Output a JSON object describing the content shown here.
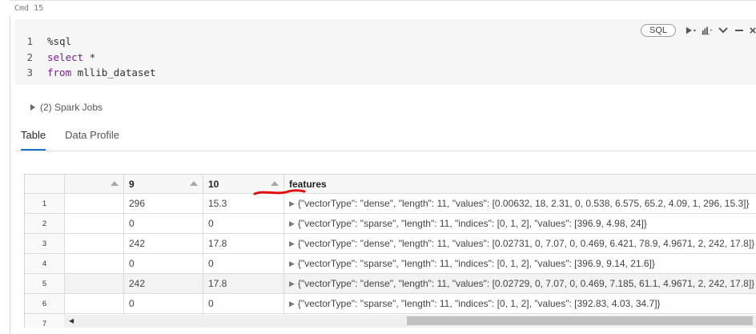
{
  "cell": {
    "label": "Cmd 15",
    "code_lines": [
      {
        "number": "1",
        "keyword": "",
        "rest": "%sql"
      },
      {
        "number": "2",
        "keyword": "select",
        "rest": " *"
      },
      {
        "number": "3",
        "keyword": "from",
        "rest": " mllib_dataset"
      }
    ],
    "language_badge": "SQL"
  },
  "results": {
    "spark_jobs": "(2) Spark Jobs",
    "tabs": [
      "Table",
      "Data Profile"
    ],
    "active_tab": "Table",
    "table": {
      "columns": [
        "",
        "9",
        "10",
        "features"
      ],
      "rows": [
        {
          "index": "1",
          "c9": "296",
          "c10": "15.3",
          "features": "{\"vectorType\": \"dense\", \"length\": 11, \"values\": [0.00632, 18, 2.31, 0, 0.538, 6.575, 65.2, 4.09, 1, 296, 15.3]}"
        },
        {
          "index": "2",
          "c9": "0",
          "c10": "0",
          "features": "{\"vectorType\": \"sparse\", \"length\": 11, \"indices\": [0, 1, 2], \"values\": [396.9, 4.98, 24]}"
        },
        {
          "index": "3",
          "c9": "242",
          "c10": "17.8",
          "features": "{\"vectorType\": \"dense\", \"length\": 11, \"values\": [0.02731, 0, 7.07, 0, 0.469, 6.421, 78.9, 4.9671, 2, 242, 17.8]}"
        },
        {
          "index": "4",
          "c9": "0",
          "c10": "0",
          "features": "{\"vectorType\": \"sparse\", \"length\": 11, \"indices\": [0, 1, 2], \"values\": [396.9, 9.14, 21.6]}"
        },
        {
          "index": "5",
          "c9": "242",
          "c10": "17.8",
          "features": "{\"vectorType\": \"dense\", \"length\": 11, \"values\": [0.02729, 0, 7.07, 0, 0.469, 7.185, 61.1, 4.9671, 2, 242, 17.8]}"
        },
        {
          "index": "6",
          "c9": "0",
          "c10": "0",
          "features": "{\"vectorType\": \"sparse\", \"length\": 11, \"indices\": [0, 1, 2], \"values\": [392.83, 4.03, 34.7]}"
        },
        {
          "index": "7",
          "c9": "",
          "c10": "",
          "features": ""
        }
      ]
    }
  },
  "colors": {
    "keyword": "#7a1d8c",
    "active_tab_underline": "#1a73c8",
    "annotation_mark": "#e01010"
  },
  "icons": [
    "run-icon",
    "chart-icon",
    "chevron-down-icon",
    "minimize-icon",
    "close-icon",
    "caret-right-icon",
    "sort-arrow-icon"
  ]
}
